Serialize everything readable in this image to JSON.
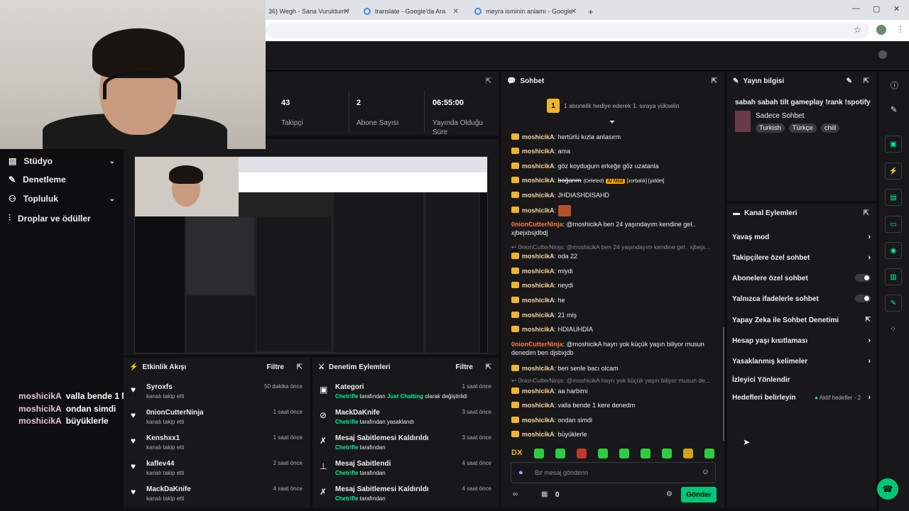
{
  "browser": {
    "tabs": [
      {
        "label": "36) Wegh - Sana Vuruldum /"
      },
      {
        "label": "translate - Google'da Ara"
      },
      {
        "label": "meyra isminin anlamı - Google"
      }
    ],
    "new_tab": "+",
    "window_controls": [
      "—",
      "▢",
      "✕"
    ]
  },
  "stats": [
    {
      "value": "43",
      "label": "Takipçi"
    },
    {
      "value": "2",
      "label": "Abone Sayısı"
    },
    {
      "value": "06:55:00",
      "label": "Yayında Olduğu Süre"
    }
  ],
  "sidebar": {
    "items": [
      {
        "label": "Stüdyo",
        "has_chevron": true
      },
      {
        "label": "Denetleme",
        "has_chevron": false
      },
      {
        "label": "Topluluk",
        "has_chevron": true
      },
      {
        "label": "Droplar ve ödüller",
        "has_chevron": false
      }
    ]
  },
  "overlay_chat": [
    {
      "user": "moshicikA",
      "msg": "valla bende 1 kere denedm"
    },
    {
      "user": "moshicikA",
      "msg": "ondan simdi"
    },
    {
      "user": "moshicikA",
      "msg": "büyüklerle"
    }
  ],
  "activity": {
    "title": "Etkinlik Akışı",
    "filter": "Filtre",
    "rows": [
      {
        "name": "Syroxfs",
        "sub": "kanalı takip etti",
        "time": "50 dakika önce"
      },
      {
        "name": "0nionCutterNinja",
        "sub": "kanalı takip etti",
        "time": "1 saat önce"
      },
      {
        "name": "Kenshxx1",
        "sub": "kanalı takip etti",
        "time": "1 saat önce"
      },
      {
        "name": "kaflev44",
        "sub": "kanalı takip etti",
        "time": "2 saat önce"
      },
      {
        "name": "MackDaKnife",
        "sub": "kanalı takip etti",
        "time": "4 saat önce"
      }
    ]
  },
  "moderation": {
    "title": "Denetim Eylemleri",
    "filter": "Filtre",
    "rows": [
      {
        "name": "Kategori",
        "actor": "Chetrifle",
        "mid": " tarafından ",
        "hl": "Just Chatting",
        "rest": " olarak değiştirildi",
        "time": "1 saat önce"
      },
      {
        "name": "MackDaKnife",
        "actor": "Chetrifle",
        "mid": " tarafından yasaklandı",
        "hl": "",
        "rest": "",
        "time": "3 saat önce"
      },
      {
        "name": "Mesaj Sabitlemesi Kaldırıldı",
        "actor": "Chetrifle",
        "mid": " tarafından",
        "hl": "",
        "rest": "",
        "time": "3 saat önce"
      },
      {
        "name": "Mesaj Sabitlendi",
        "actor": "Chetrifle",
        "mid": " tarafından",
        "hl": "",
        "rest": "",
        "time": "4 saat önce"
      },
      {
        "name": "Mesaj Sabitlemesi Kaldırıldı",
        "actor": "Chetrifle",
        "mid": " tarafından",
        "hl": "",
        "rest": "",
        "time": "4 saat önce"
      }
    ]
  },
  "chat": {
    "title": "Sohbet",
    "gift_banner": "1 abonelik hediye ederek 1. sıraya yükselin",
    "gift_rank": "1",
    "messages": [
      {
        "type": "msg",
        "user": "moshicikA",
        "text": "hertürlü kızla anlasırm"
      },
      {
        "type": "msg",
        "user": "moshicikA",
        "text": "ama"
      },
      {
        "type": "msg",
        "user": "moshicikA",
        "text": "göz koydugum erkeğe göz uzatanla"
      },
      {
        "type": "del",
        "user": "moshicikA",
        "text": "boğarım",
        "deleted": "(Deleted)",
        "ai": "AI Mod",
        "tags": "[zorbalık] [şiddet]"
      },
      {
        "type": "msg",
        "user": "moshicikA",
        "text": "JHDIASHDISAHD"
      },
      {
        "type": "msg",
        "user": "moshicikA",
        "text": ""
      },
      {
        "type": "msg2",
        "user": "0nionCutterNinja",
        "text": "@moshicikA ben 24 yaşındayım kendine gel.. xjbejxbsjdbdj"
      },
      {
        "type": "reply",
        "text": "↩ 0nionCutterNinja: @moshicikA ben 24 yaşındayım kendine gel.. xjbejx..."
      },
      {
        "type": "msg",
        "user": "moshicikA",
        "text": "oda 22"
      },
      {
        "type": "msg",
        "user": "moshicikA",
        "text": "miydi"
      },
      {
        "type": "msg",
        "user": "moshicikA",
        "text": "neydi"
      },
      {
        "type": "msg",
        "user": "moshicikA",
        "text": "he"
      },
      {
        "type": "msg",
        "user": "moshicikA",
        "text": "21 miş"
      },
      {
        "type": "msg",
        "user": "moshicikA",
        "text": "HDIAUHDIA"
      },
      {
        "type": "msg2",
        "user": "0nionCutterNinja",
        "text": "@moshicikA hayrı yok küçük yaşın biliyor musun denedim ben djsbxjdb"
      },
      {
        "type": "msg",
        "user": "moshicikA",
        "text": "ben senle bacı olcam"
      },
      {
        "type": "reply",
        "text": "↩ 0nionCutterNinja: @moshicikA hayrı yok küçük yaşın biliyor musun de..."
      },
      {
        "type": "msg",
        "user": "moshicikA",
        "text": "aa harbimi"
      },
      {
        "type": "msg",
        "user": "moshicikA",
        "text": "valla bende 1 kere denedm"
      },
      {
        "type": "msg",
        "user": "moshicikA",
        "text": "ondan simdi"
      },
      {
        "type": "msg",
        "user": "moshicikA",
        "text": "büyüklerle"
      }
    ],
    "input_placeholder": "Bir mesaj gönderin",
    "points": "0",
    "send": "Gönder"
  },
  "stream_info": {
    "title": "Yayın bilgisi",
    "stream_title": "sabah sabah tilt gameplay !rank !spotify",
    "category": "Sadece Sohbet",
    "tags": [
      "Turkish",
      "Türkçe",
      "chill"
    ]
  },
  "channel_actions": {
    "title": "Kanal Eylemleri",
    "rows": [
      {
        "label": "Yavaş mod",
        "kind": "chevron"
      },
      {
        "label": "Takipçilere özel sohbet",
        "kind": "chevron"
      },
      {
        "label": "Abonelere özel sohbet",
        "kind": "toggle"
      },
      {
        "label": "Yalnızca ifadelerle sohbet",
        "kind": "toggle"
      },
      {
        "label": "Yapay Zeka ile Sohbet Denetimi",
        "kind": "external"
      },
      {
        "label": "Hesap yaşı kısıtlaması",
        "kind": "chevron"
      },
      {
        "label": "Yasaklanmış kelimeler",
        "kind": "chevron"
      },
      {
        "label": "İzleyici Yönlendir",
        "kind": "none"
      },
      {
        "label": "Hedefleri belirleyin",
        "kind": "goal",
        "extra": "Aktif hedefler - 2"
      }
    ]
  },
  "colors": {
    "accent": "#00f593",
    "bg": "#0e0e10",
    "panel": "#18181b",
    "badge": "#f0b429"
  }
}
